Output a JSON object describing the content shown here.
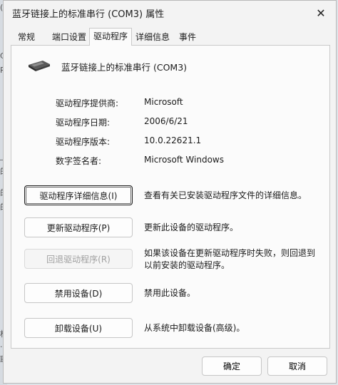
{
  "window": {
    "title": "蓝牙链接上的标准串行 (COM3) 属性",
    "close_glyph": "✕"
  },
  "tabs": [
    {
      "label": "常规"
    },
    {
      "label": "端口设置"
    },
    {
      "label": "驱动程序"
    },
    {
      "label": "详细信息"
    },
    {
      "label": "事件"
    }
  ],
  "active_tab": "驱动程序",
  "device": {
    "name": "蓝牙链接上的标准串行 (COM3)",
    "icon": "serial-port-device-icon"
  },
  "driver_info": [
    {
      "label": "驱动程序提供商:",
      "value": "Microsoft"
    },
    {
      "label": "驱动程序日期:",
      "value": "2006/6/21"
    },
    {
      "label": "驱动程序版本:",
      "value": "10.0.22621.1"
    },
    {
      "label": "数字签名者:",
      "value": "Microsoft Windows"
    }
  ],
  "actions": [
    {
      "label": "驱动程序详细信息(I)",
      "description": "查看有关已安装驱动程序文件的详细信息。",
      "enabled": true
    },
    {
      "label": "更新驱动程序(P)",
      "description": "更新此设备的驱动程序。",
      "enabled": true
    },
    {
      "label": "回退驱动程序(R)",
      "description": "如果该设备在更新驱动程序时失败，则回退到以前安装的驱动程序。",
      "enabled": false
    },
    {
      "label": "禁用设备(D)",
      "description": "禁用此设备。",
      "enabled": true
    },
    {
      "label": "卸载设备(U)",
      "description": "从系统中卸载设备(高级)。",
      "enabled": true
    }
  ],
  "footer": {
    "ok_label": "确定",
    "cancel_label": "取消"
  },
  "background_fragments": [
    "(\\",
    "C",
    "P",
    "_F",
    "的",
    "的",
    "的",
    "权",
    "·计",
    "取"
  ]
}
